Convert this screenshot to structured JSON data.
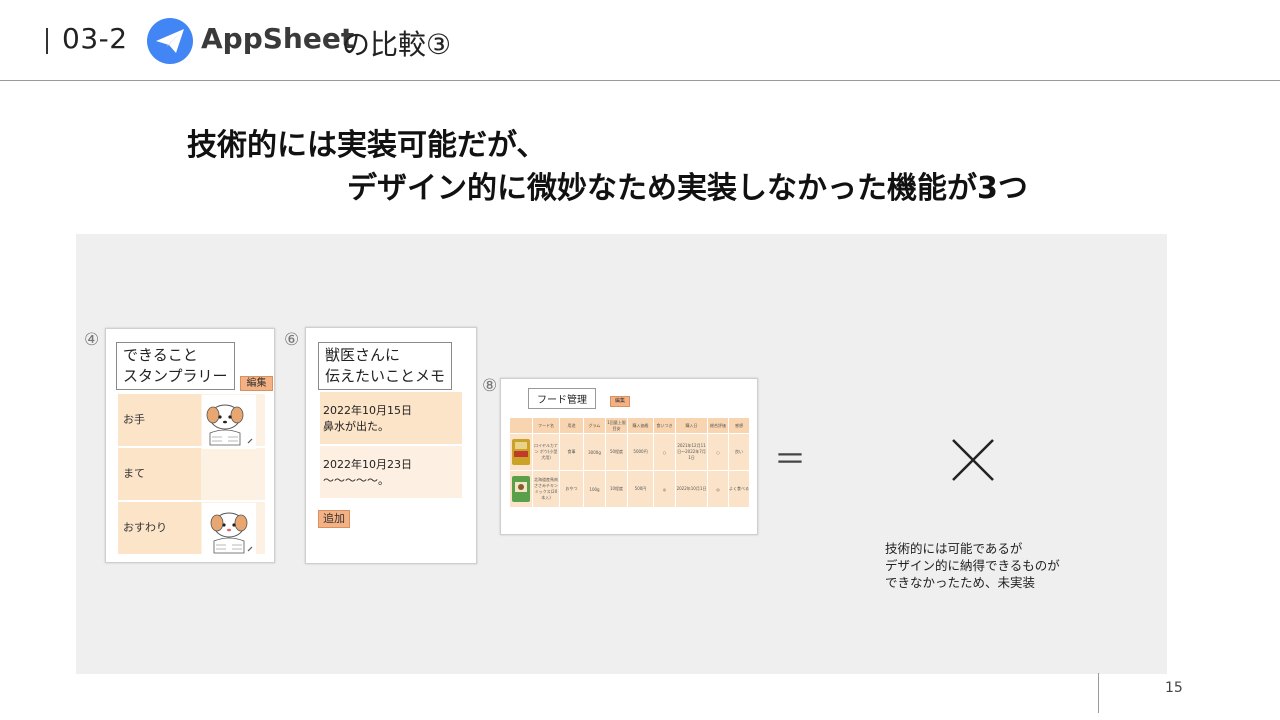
{
  "header": {
    "section_number": "03-2",
    "app_name": "AppSheet",
    "title_suffix": "の比較③",
    "logo_icon": "appsheet-paper-plane-icon",
    "brand_color": "#4285f4"
  },
  "headline": {
    "line1": "技術的には実装可能だが、",
    "line2": "デザイン的に微妙なため実装しなかった機能が3つ"
  },
  "features": [
    {
      "number": "④",
      "title_line1": "できること",
      "title_line2": "スタンプラリー",
      "tag": "編集",
      "rows": [
        {
          "label": "お手",
          "stamp": "dog-stamp-icon"
        },
        {
          "label": "まて",
          "stamp": ""
        },
        {
          "label": "おすわり",
          "stamp": "dog-stamp-icon"
        }
      ]
    },
    {
      "number": "⑥",
      "title_line1": "獣医さんに",
      "title_line2": "伝えたいことメモ",
      "button": "追加",
      "memos": [
        {
          "date": "2022年10月15日",
          "text": "鼻水が出た。"
        },
        {
          "date": "2022年10月23日",
          "text": "〜〜〜〜〜。"
        }
      ]
    },
    {
      "number": "⑧",
      "title": "フード管理",
      "tag": "編集",
      "columns": [
        "",
        "フード名",
        "用途",
        "グラム",
        "1回量上限目安",
        "購入価格",
        "食いつき",
        "購入日",
        "総合評価",
        "感想"
      ],
      "rows": [
        [
          "",
          "ロイヤルカナン ボウ(小型犬用)",
          "食事",
          "3000g",
          "50程度",
          "5000円",
          "○",
          "2021年12月11日〜2022年7月1日",
          "○",
          "良い"
        ],
        [
          "",
          "北海道産馬肉 ささみチキン ミックス(20本入)",
          "おやつ",
          "100g",
          "10程度",
          "500円",
          "◎",
          "2022年10月1日",
          "◎",
          "よく食べる"
        ]
      ]
    }
  ],
  "comparison": {
    "equals": "＝",
    "verdict_icon": "cross-icon",
    "note_line1": "技術的には可能であるが",
    "note_line2": "デザイン的に納得できるものが",
    "note_line3": "できなかったため、未実装"
  },
  "page_number": "15",
  "colors": {
    "panel_bg": "#efefef",
    "row_peach": "#fce4c8",
    "tag_orange": "#f4b183"
  }
}
